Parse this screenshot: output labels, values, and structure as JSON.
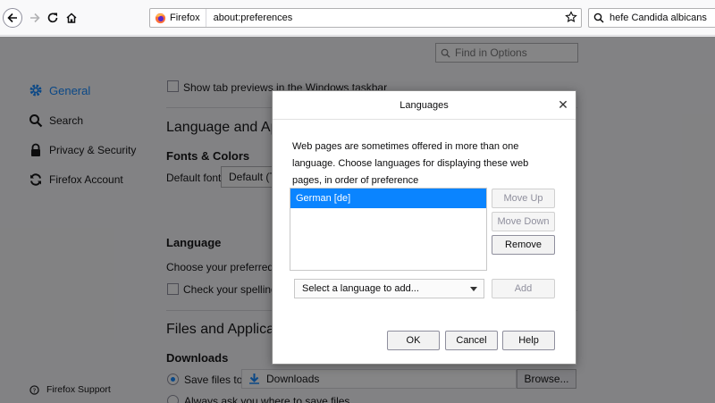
{
  "toolbar": {
    "identity_label": "Firefox",
    "url": "about:preferences",
    "search_text": "hefe  Candida albicans"
  },
  "page": {
    "find_placeholder": "Find in Options",
    "nav": [
      {
        "label": "General"
      },
      {
        "label": "Search"
      },
      {
        "label": "Privacy & Security"
      },
      {
        "label": "Firefox Account"
      }
    ],
    "support_label": "Firefox Support",
    "tab_previews": "Show tab previews in the Windows taskbar",
    "language_appearance": "Language and App",
    "fonts_colors": "Fonts & Colors",
    "default_font_label": "Default font",
    "default_font_value": "Default (Ti",
    "language_heading": "Language",
    "choose_language": "Choose your preferred la",
    "check_spelling": "Check your spelling as",
    "files_applications": "Files and Applicatio",
    "downloads_heading": "Downloads",
    "save_files_to": "Save files to",
    "downloads_folder": "Downloads",
    "browse_label": "Browse...",
    "always_ask": "Always ask you where to save files"
  },
  "dialog": {
    "title": "Languages",
    "description": "Web pages are sometimes offered in more than one language. Choose languages for displaying these web pages, in order of preference",
    "languages": [
      "German  [de]"
    ],
    "move_up": "Move Up",
    "move_down": "Move Down",
    "remove": "Remove",
    "select_placeholder": "Select a language to add...",
    "add": "Add",
    "ok": "OK",
    "cancel": "Cancel",
    "help": "Help"
  },
  "colors": {
    "accent": "#0a84ff",
    "firefox_orange": "#ff7139",
    "overlay": "rgba(12,12,13,0.5)"
  }
}
